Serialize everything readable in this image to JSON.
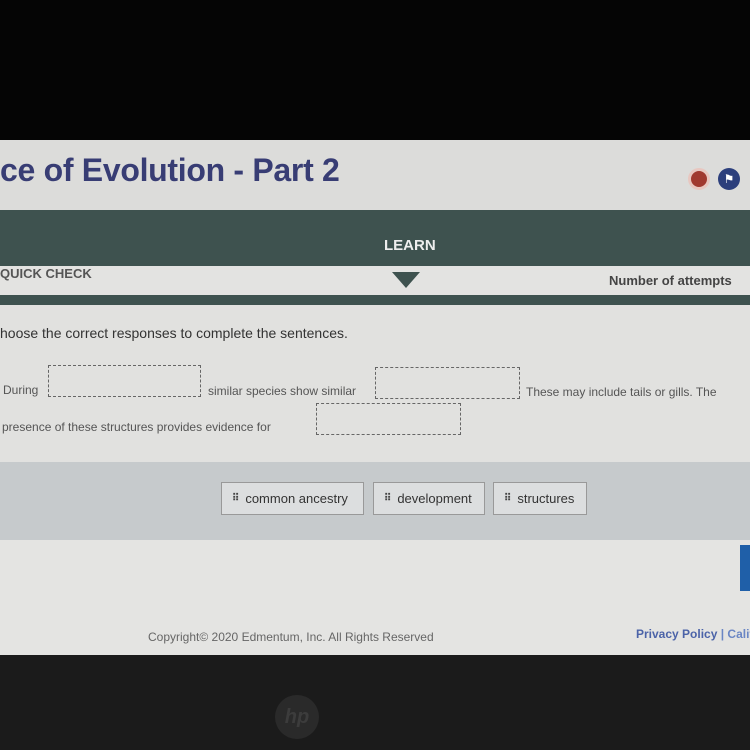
{
  "header": {
    "title": "ce of Evolution - Part 2",
    "icons": [
      "settings-icon",
      "flag-icon"
    ]
  },
  "nav": {
    "active_tab": "LEARN",
    "section": "QUICK CHECK",
    "attempts_label": "Number of attempts"
  },
  "question": {
    "instruction": "hoose the correct responses to complete the sentences.",
    "s1_a": "During",
    "s1_b": "similar species show similar",
    "s1_c": "These may include tails or gills. The",
    "s2_a": "presence of these structures provides evidence for"
  },
  "options": [
    "common ancestry",
    "development",
    "structures"
  ],
  "footer": {
    "copyright": "Copyright© 2020 Edmentum, Inc. All Rights Reserved",
    "privacy": "Privacy Policy",
    "california": "| Califo"
  },
  "colors": {
    "title": "#383d74",
    "nav": "#3e524f",
    "button": "#1f5fa8"
  }
}
